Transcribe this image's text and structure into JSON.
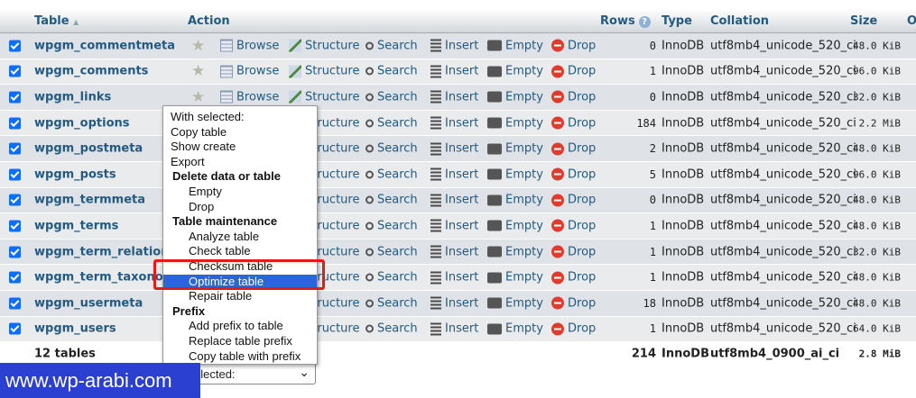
{
  "header": {
    "table": "Table",
    "sort_arrow": "▲",
    "action": "Action",
    "rows": "Rows",
    "rows_help": "?",
    "type": "Type",
    "collation": "Collation",
    "size": "Size",
    "overhead": "O"
  },
  "actions": {
    "browse": "Browse",
    "structure": "Structure",
    "search": "Search",
    "insert": "Insert",
    "empty": "Empty",
    "drop": "Drop"
  },
  "tables": [
    {
      "name": "wpgm_commentmeta",
      "rows": "0",
      "type": "InnoDB",
      "collation": "utf8mb4_unicode_520_ci",
      "size": "48.0 KiB"
    },
    {
      "name": "wpgm_comments",
      "rows": "1",
      "type": "InnoDB",
      "collation": "utf8mb4_unicode_520_ci",
      "size": "96.0 KiB"
    },
    {
      "name": "wpgm_links",
      "rows": "0",
      "type": "InnoDB",
      "collation": "utf8mb4_unicode_520_ci",
      "size": "32.0 KiB"
    },
    {
      "name": "wpgm_options",
      "rows": "184",
      "type": "InnoDB",
      "collation": "utf8mb4_unicode_520_ci",
      "size": "2.2 MiB"
    },
    {
      "name": "wpgm_postmeta",
      "rows": "2",
      "type": "InnoDB",
      "collation": "utf8mb4_unicode_520_ci",
      "size": "48.0 KiB"
    },
    {
      "name": "wpgm_posts",
      "rows": "5",
      "type": "InnoDB",
      "collation": "utf8mb4_unicode_520_ci",
      "size": "96.0 KiB"
    },
    {
      "name": "wpgm_termmeta",
      "rows": "0",
      "type": "InnoDB",
      "collation": "utf8mb4_unicode_520_ci",
      "size": "48.0 KiB"
    },
    {
      "name": "wpgm_terms",
      "rows": "1",
      "type": "InnoDB",
      "collation": "utf8mb4_unicode_520_ci",
      "size": "48.0 KiB"
    },
    {
      "name": "wpgm_term_relationsh",
      "rows": "1",
      "type": "InnoDB",
      "collation": "utf8mb4_unicode_520_ci",
      "size": "32.0 KiB"
    },
    {
      "name": "wpgm_term_taxonom",
      "rows": "1",
      "type": "InnoDB",
      "collation": "utf8mb4_unicode_520_ci",
      "size": "48.0 KiB"
    },
    {
      "name": "wpgm_usermeta",
      "rows": "18",
      "type": "InnoDB",
      "collation": "utf8mb4_unicode_520_ci",
      "size": "48.0 KiB"
    },
    {
      "name": "wpgm_users",
      "rows": "1",
      "type": "InnoDB",
      "collation": "utf8mb4_unicode_520_ci",
      "size": "64.0 KiB"
    }
  ],
  "footer": {
    "count": "12 tables",
    "rows": "214",
    "type": "InnoDB",
    "collation": "utf8mb4_0900_ai_ci",
    "size": "2.8 MiB"
  },
  "menu": {
    "items": [
      {
        "label": "With selected:",
        "kind": "plain"
      },
      {
        "label": "Copy table",
        "kind": "plain"
      },
      {
        "label": "Show create",
        "kind": "plain"
      },
      {
        "label": "Export",
        "kind": "plain"
      },
      {
        "label": "Delete data or table",
        "kind": "group"
      },
      {
        "label": "Empty",
        "kind": "indent"
      },
      {
        "label": "Drop",
        "kind": "indent"
      },
      {
        "label": "Table maintenance",
        "kind": "group"
      },
      {
        "label": "Analyze table",
        "kind": "indent"
      },
      {
        "label": "Check table",
        "kind": "indent"
      },
      {
        "label": "Checksum table",
        "kind": "indent"
      },
      {
        "label": "Optimize table",
        "kind": "selected"
      },
      {
        "label": "Repair table",
        "kind": "indent"
      },
      {
        "label": "Prefix",
        "kind": "group"
      },
      {
        "label": "Add prefix to table",
        "kind": "indent"
      },
      {
        "label": "Replace table prefix",
        "kind": "indent"
      },
      {
        "label": "Copy table with prefix",
        "kind": "indent"
      }
    ]
  },
  "select_box": {
    "value": "elected:"
  },
  "watermark": "www.wp-arabi.com",
  "colors": {
    "highlight": "#2a66d8",
    "annotation": "#e21b1b",
    "watermark_bg": "#2b3fd0"
  }
}
